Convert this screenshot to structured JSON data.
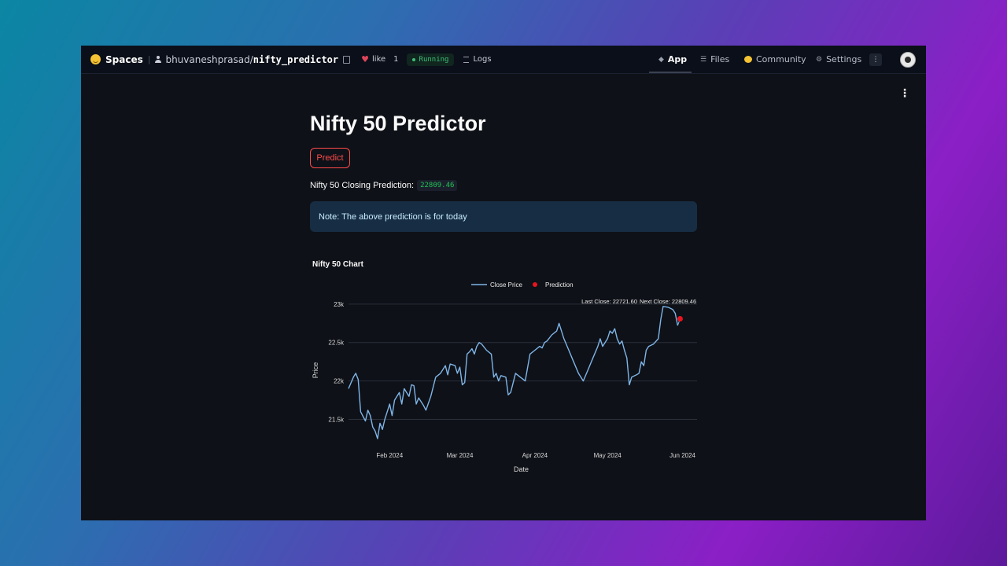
{
  "header": {
    "spaces_label": "Spaces",
    "owner": "bhuvaneshprasad",
    "slash": "/",
    "repo": "nifty_predictor",
    "like_label": "like",
    "like_count": "1",
    "status": "Running",
    "logs_label": "Logs",
    "nav": {
      "app": "App",
      "files": "Files",
      "community": "Community",
      "settings": "Settings"
    }
  },
  "main": {
    "title": "Nifty 50 Predictor",
    "predict_button": "Predict",
    "prediction_label": "Nifty 50 Closing Prediction:",
    "prediction_value": "22809.46",
    "note": "Note: The above prediction is for today",
    "chart_heading": "Nifty 50 Chart"
  },
  "chart_data": {
    "type": "line",
    "title": "Nifty 50 Chart",
    "xlabel": "Date",
    "ylabel": "Price",
    "ylim": [
      21250,
      23070
    ],
    "yticks": [
      21500,
      22000,
      22500,
      23000
    ],
    "ytick_labels": [
      "21.5k",
      "22k",
      "22.5k",
      "23k"
    ],
    "xticks": [
      "2024-02-01",
      "2024-03-01",
      "2024-04-01",
      "2024-05-01",
      "2024-06-01"
    ],
    "xtick_labels": [
      "Feb 2024",
      "Mar 2024",
      "Apr 2024",
      "May 2024",
      "Jun 2024"
    ],
    "xlim": [
      "2024-01-15",
      "2024-06-07"
    ],
    "grid": "horizontal",
    "legend": "top-center",
    "colors": {
      "close": "#7fb5e8",
      "prediction": "#e8141e"
    },
    "series": [
      {
        "name": "Close Price",
        "points": [
          [
            "2024-01-15",
            21900
          ],
          [
            "2024-01-17",
            22050
          ],
          [
            "2024-01-18",
            22100
          ],
          [
            "2024-01-19",
            22020
          ],
          [
            "2024-01-20",
            21600
          ],
          [
            "2024-01-22",
            21480
          ],
          [
            "2024-01-23",
            21620
          ],
          [
            "2024-01-24",
            21550
          ],
          [
            "2024-01-25",
            21400
          ],
          [
            "2024-01-26",
            21350
          ],
          [
            "2024-01-27",
            21250
          ],
          [
            "2024-01-28",
            21450
          ],
          [
            "2024-01-29",
            21370
          ],
          [
            "2024-01-30",
            21500
          ],
          [
            "2024-01-31",
            21600
          ],
          [
            "2024-02-01",
            21700
          ],
          [
            "2024-02-02",
            21550
          ],
          [
            "2024-02-03",
            21750
          ],
          [
            "2024-02-05",
            21850
          ],
          [
            "2024-02-06",
            21700
          ],
          [
            "2024-02-07",
            21900
          ],
          [
            "2024-02-08",
            21850
          ],
          [
            "2024-02-09",
            21800
          ],
          [
            "2024-02-10",
            21950
          ],
          [
            "2024-02-11",
            21940
          ],
          [
            "2024-02-12",
            21700
          ],
          [
            "2024-02-13",
            21780
          ],
          [
            "2024-02-15",
            21680
          ],
          [
            "2024-02-16",
            21620
          ],
          [
            "2024-02-18",
            21800
          ],
          [
            "2024-02-20",
            22050
          ],
          [
            "2024-02-22",
            22100
          ],
          [
            "2024-02-24",
            22200
          ],
          [
            "2024-02-25",
            22080
          ],
          [
            "2024-02-26",
            22220
          ],
          [
            "2024-02-28",
            22200
          ],
          [
            "2024-02-29",
            22100
          ],
          [
            "2024-03-01",
            22180
          ],
          [
            "2024-03-02",
            21950
          ],
          [
            "2024-03-03",
            21980
          ],
          [
            "2024-03-04",
            22350
          ],
          [
            "2024-03-05",
            22380
          ],
          [
            "2024-03-06",
            22420
          ],
          [
            "2024-03-07",
            22350
          ],
          [
            "2024-03-08",
            22450
          ],
          [
            "2024-03-09",
            22500
          ],
          [
            "2024-03-10",
            22480
          ],
          [
            "2024-03-12",
            22400
          ],
          [
            "2024-03-14",
            22350
          ],
          [
            "2024-03-15",
            22050
          ],
          [
            "2024-03-16",
            22100
          ],
          [
            "2024-03-17",
            22000
          ],
          [
            "2024-03-18",
            22070
          ],
          [
            "2024-03-20",
            22050
          ],
          [
            "2024-03-21",
            21820
          ],
          [
            "2024-03-22",
            21850
          ],
          [
            "2024-03-24",
            22100
          ],
          [
            "2024-03-26",
            22050
          ],
          [
            "2024-03-28",
            22000
          ],
          [
            "2024-03-30",
            22350
          ],
          [
            "2024-04-01",
            22400
          ],
          [
            "2024-04-03",
            22450
          ],
          [
            "2024-04-04",
            22430
          ],
          [
            "2024-04-05",
            22500
          ],
          [
            "2024-04-06",
            22520
          ],
          [
            "2024-04-08",
            22600
          ],
          [
            "2024-04-10",
            22650
          ],
          [
            "2024-04-11",
            22750
          ],
          [
            "2024-04-12",
            22650
          ],
          [
            "2024-04-13",
            22550
          ],
          [
            "2024-04-15",
            22400
          ],
          [
            "2024-04-17",
            22250
          ],
          [
            "2024-04-19",
            22100
          ],
          [
            "2024-04-21",
            22000
          ],
          [
            "2024-04-23",
            22150
          ],
          [
            "2024-04-25",
            22300
          ],
          [
            "2024-04-27",
            22450
          ],
          [
            "2024-04-28",
            22550
          ],
          [
            "2024-04-29",
            22450
          ],
          [
            "2024-04-30",
            22500
          ],
          [
            "2024-05-01",
            22550
          ],
          [
            "2024-05-02",
            22650
          ],
          [
            "2024-05-03",
            22620
          ],
          [
            "2024-05-04",
            22680
          ],
          [
            "2024-05-05",
            22550
          ],
          [
            "2024-05-06",
            22480
          ],
          [
            "2024-05-07",
            22520
          ],
          [
            "2024-05-08",
            22400
          ],
          [
            "2024-05-09",
            22300
          ],
          [
            "2024-05-10",
            21950
          ],
          [
            "2024-05-11",
            22050
          ],
          [
            "2024-05-13",
            22080
          ],
          [
            "2024-05-14",
            22100
          ],
          [
            "2024-05-15",
            22250
          ],
          [
            "2024-05-16",
            22200
          ],
          [
            "2024-05-17",
            22400
          ],
          [
            "2024-05-18",
            22450
          ],
          [
            "2024-05-20",
            22480
          ],
          [
            "2024-05-22",
            22550
          ],
          [
            "2024-05-23",
            22800
          ],
          [
            "2024-05-24",
            22970
          ],
          [
            "2024-05-26",
            22960
          ],
          [
            "2024-05-28",
            22930
          ],
          [
            "2024-05-29",
            22880
          ],
          [
            "2024-05-30",
            22721.6
          ]
        ]
      },
      {
        "name": "Prediction",
        "points": [
          [
            "2024-05-31",
            22809.46
          ]
        ]
      }
    ],
    "annotations": [
      {
        "text": "Last Close: 22721.60",
        "x": "2024-05-30",
        "y": 22721.6
      },
      {
        "text": "Next Close: 22809.46",
        "x": "2024-05-31",
        "y": 22809.46
      }
    ]
  }
}
